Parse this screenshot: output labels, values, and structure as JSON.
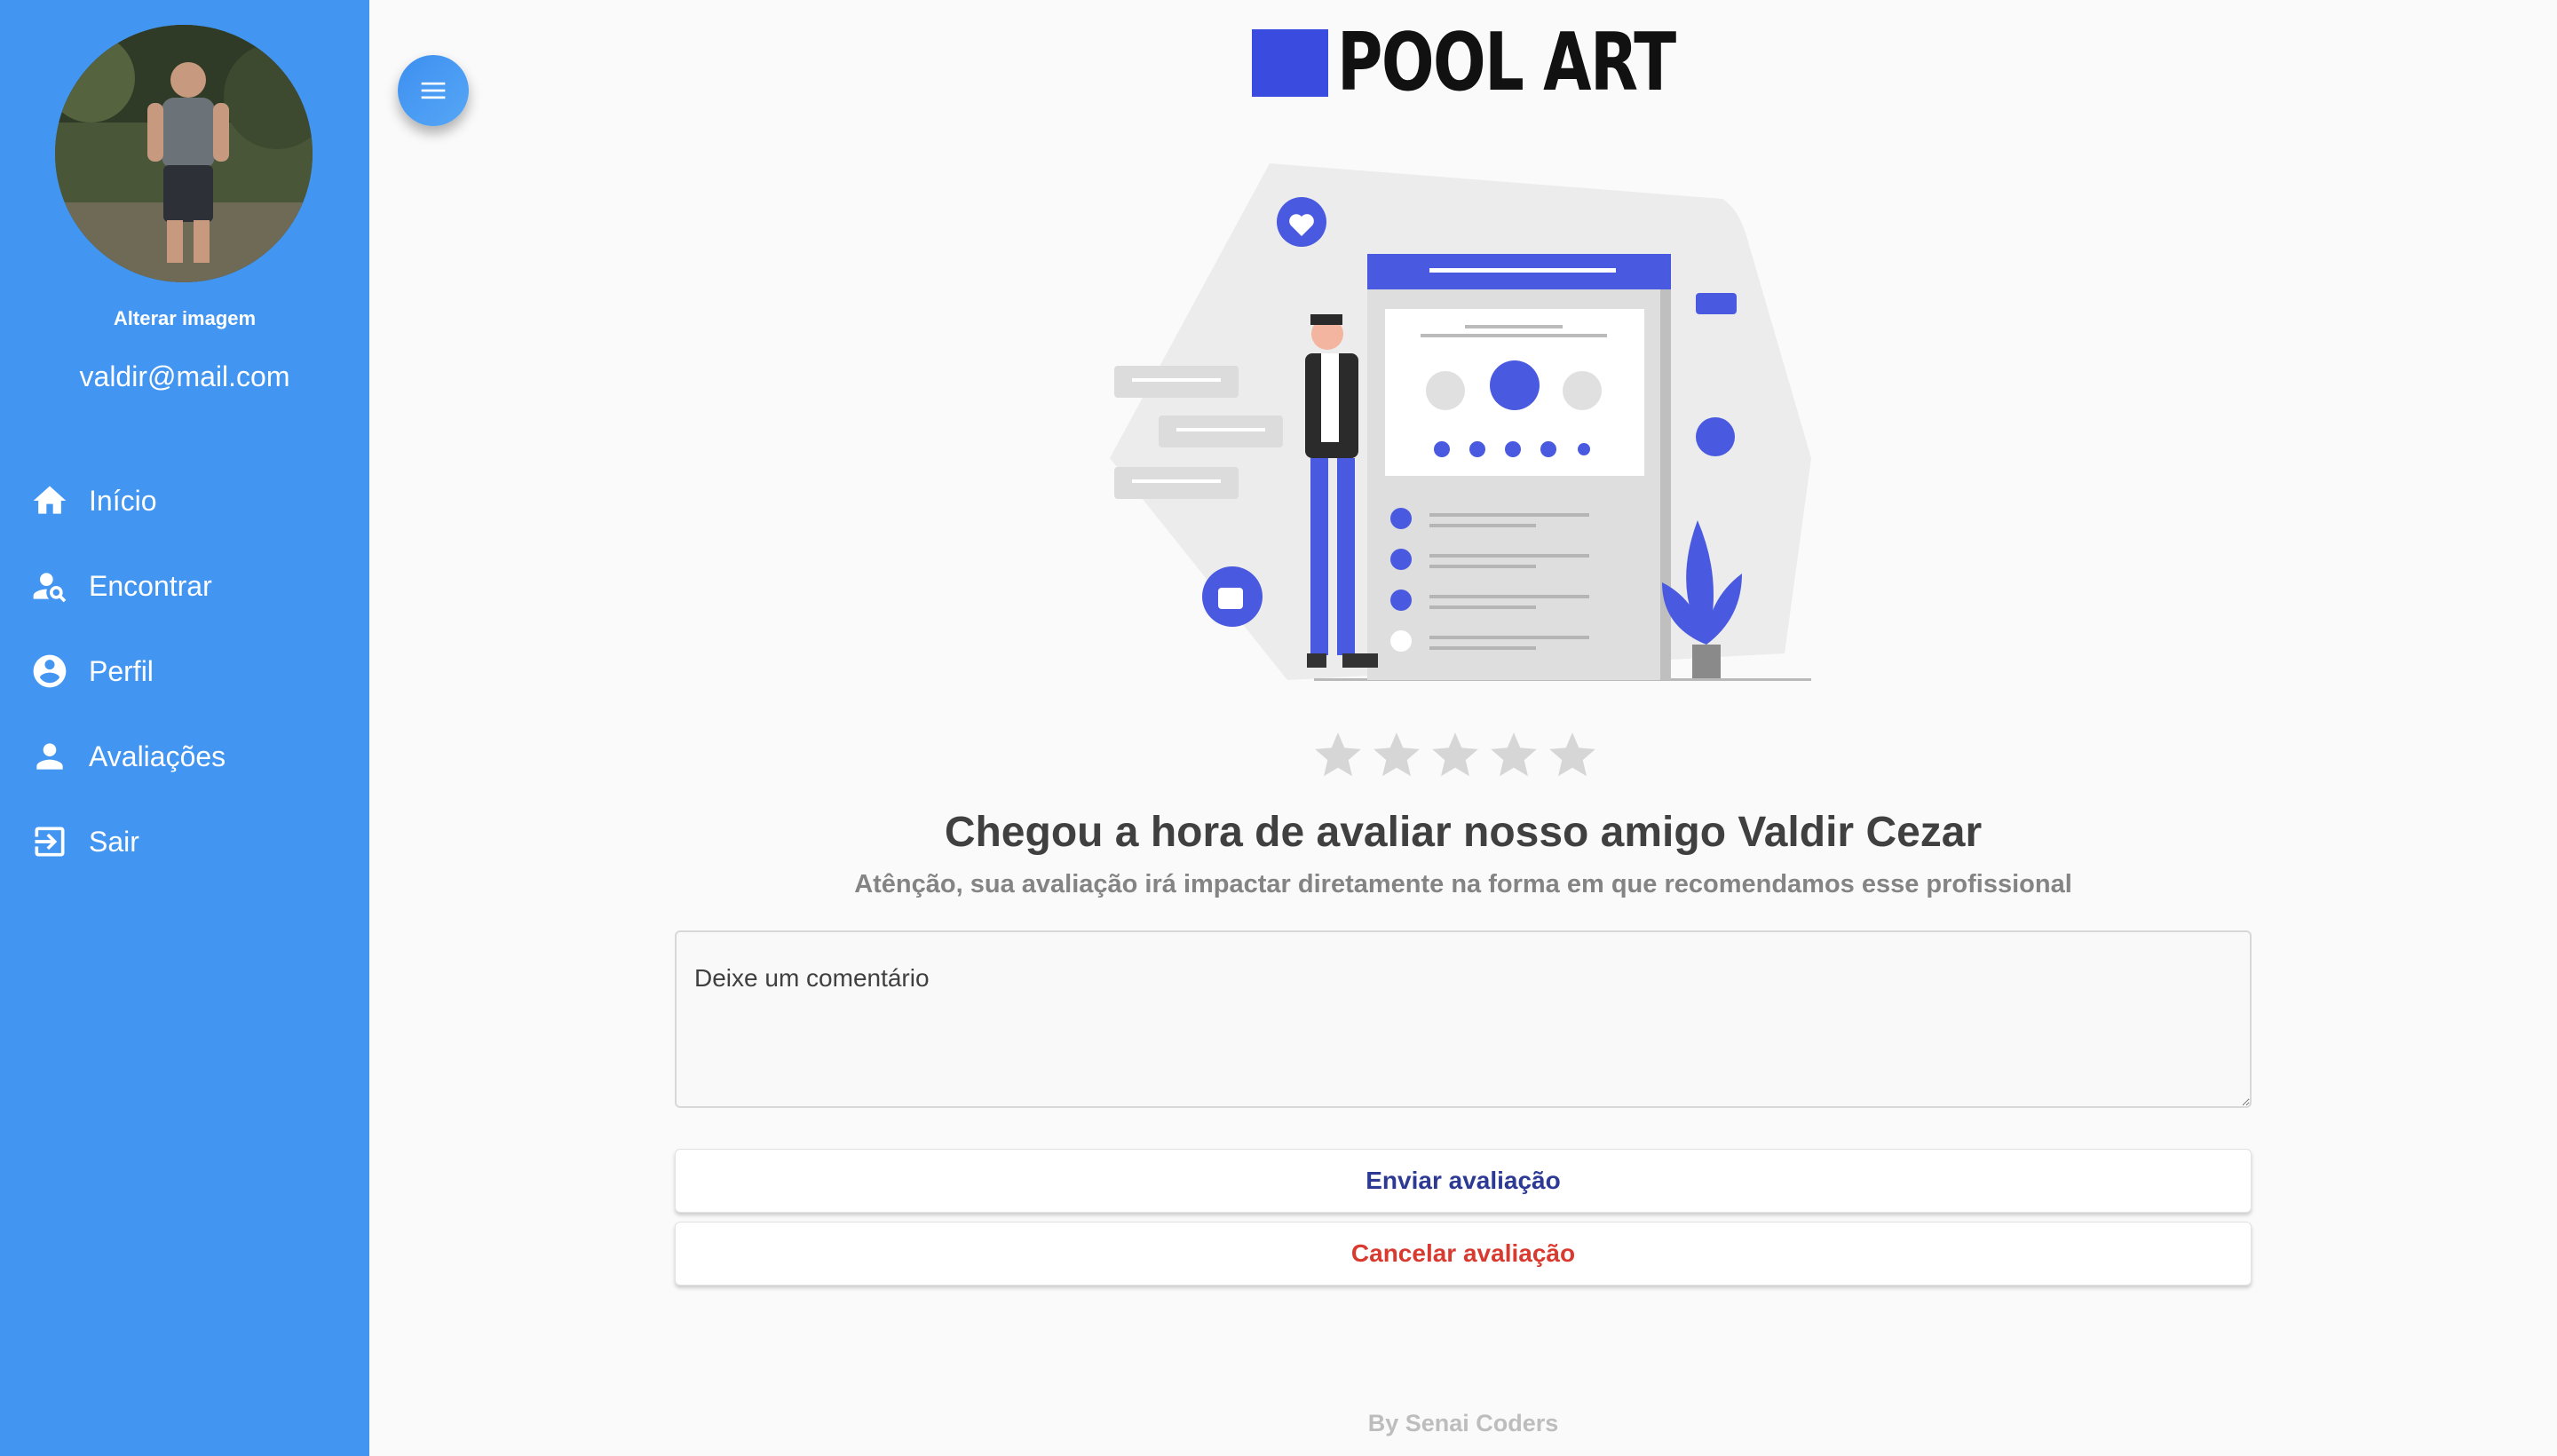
{
  "sidebar": {
    "change_image_label": "Alterar imagem",
    "email": "valdir@mail.com",
    "items": [
      {
        "label": "Início",
        "icon": "home-icon"
      },
      {
        "label": "Encontrar",
        "icon": "person-search-icon"
      },
      {
        "label": "Perfil",
        "icon": "account-circle-icon"
      },
      {
        "label": "Avaliações",
        "icon": "person-icon"
      },
      {
        "label": "Sair",
        "icon": "logout-icon"
      }
    ],
    "background_color": "#4295f0"
  },
  "menu_button": {
    "icon": "hamburger-menu-icon"
  },
  "brand": {
    "name": "POOL ART",
    "accent_color": "#3a4be0"
  },
  "rating": {
    "max_stars": 5,
    "selected": 0
  },
  "main": {
    "heading": "Chegou a hora de avaliar nosso amigo Valdir Cezar",
    "subheading": "Atênção, sua avaliação irá impactar diretamente na forma em que recomendamos esse profissional",
    "comment_placeholder": "Deixe um comentário",
    "submit_label": "Enviar avaliação",
    "cancel_label": "Cancelar avaliação"
  },
  "footer": {
    "text": "By Senai Coders"
  }
}
